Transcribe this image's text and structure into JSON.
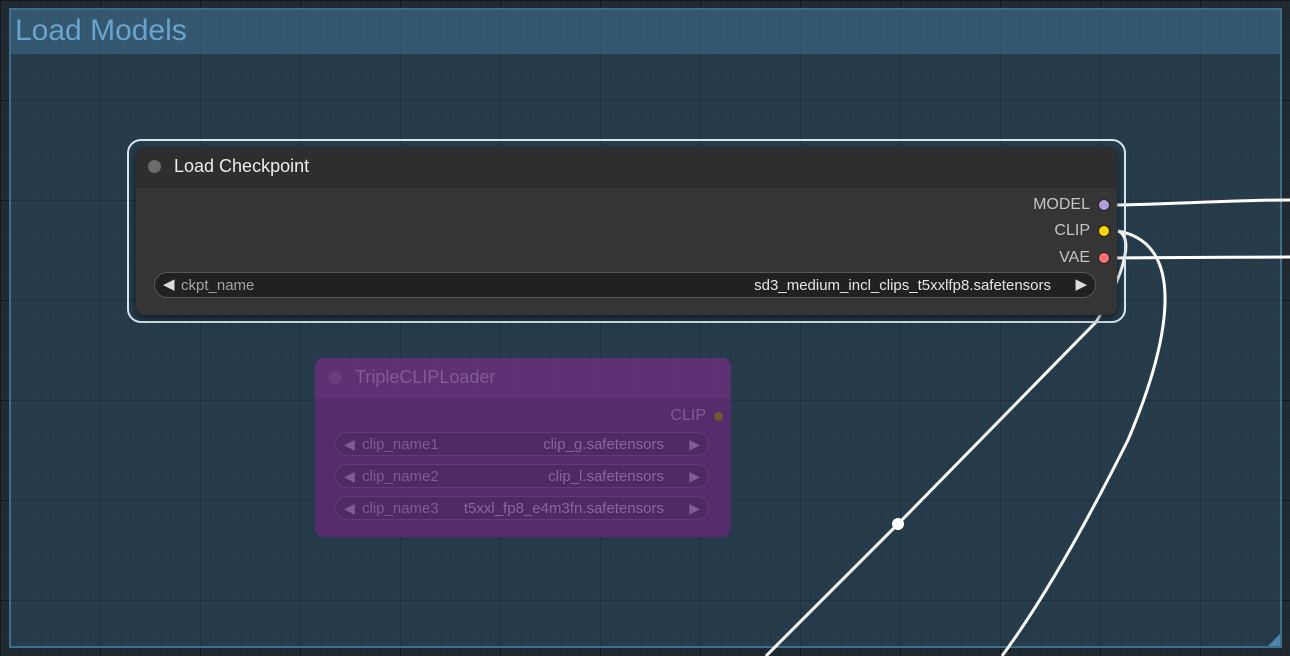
{
  "group": {
    "title": "Load Models"
  },
  "load_checkpoint": {
    "title": "Load Checkpoint",
    "outputs": [
      {
        "label": "MODEL",
        "color": "#b39ddb"
      },
      {
        "label": "CLIP",
        "color": "#ffd500"
      },
      {
        "label": "VAE",
        "color": "#ff6e6e"
      }
    ],
    "widget": {
      "name": "ckpt_name",
      "value": "sd3_medium_incl_clips_t5xxlfp8.safetensors",
      "left_arrow": "◀",
      "right_arrow": "▶"
    }
  },
  "triple_clip_loader": {
    "title": "TripleCLIPLoader",
    "output": {
      "label": "CLIP",
      "color": "#7a5b2e"
    },
    "widgets": [
      {
        "name": "clip_name1",
        "value": "clip_g.safetensors"
      },
      {
        "name": "clip_name2",
        "value": "clip_l.safetensors"
      },
      {
        "name": "clip_name3",
        "value": "t5xxl_fp8_e4m3fn.safetensors"
      }
    ],
    "left_arrow": "◀",
    "right_arrow": "▶"
  },
  "colors": {
    "canvas_bg": "#222a31",
    "group_border": "#3f6f8e",
    "link": "#ffffff",
    "node_bg": "#353535",
    "muted_node_bg": "#5b2b70"
  }
}
